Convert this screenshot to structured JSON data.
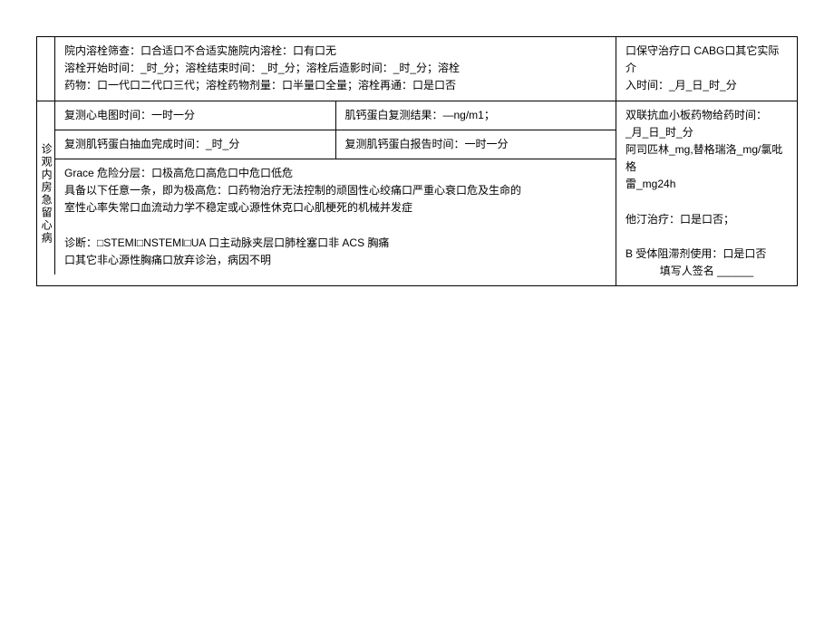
{
  "row1": {
    "left_line1": "院内溶栓筛查：口合适口不合适实施院内溶栓：口有口无",
    "left_line2": "溶栓开始时间：_时_分；溶栓结束时间：_时_分；溶栓后造影时间：_时_分；溶栓",
    "left_line3": "药物：口一代口二代口三代；溶栓药物剂量：口半量口全量；溶栓再通：口是口否",
    "right_line1": "口保守治疗口 CABG口其它实际介",
    "right_line2": "入时间：_月_日_时_分"
  },
  "row2": {
    "vlabel": "诊观内房急留心病",
    "sub1_left": "复测心电图时间：一时一分",
    "sub1_right": "肌钙蛋白复测结果：—ng/m1；",
    "sub2_left": "复测肌钙蛋白抽血完成时间：_时_分",
    "sub2_right": "复测肌钙蛋白报告时间：一时一分",
    "grace_line1": "Grace 危险分层：口极高危口高危口中危口低危",
    "grace_line2": "具备以下任意一条，即为极高危：口药物治疗无法控制的顽固性心绞痛口严重心衰口危及生命的",
    "grace_line3": "室性心率失常口血流动力学不稳定或心源性休克口心肌梗死的机械并发症",
    "diag_line1": "诊断：□STEMI□NSTEMI□UA 口主动脉夹层口肺栓塞口非 ACS 胸痛",
    "diag_line2": "口其它非心源性胸痛口放弃诊治，病因不明",
    "r_line1": "双联抗血小板药物给药时间：",
    "r_line2": "_月_日_时_分",
    "r_line3": "阿司匹林_mg,替格瑞洛_mg/氯吡格",
    "r_line4": "雷_mg24h",
    "r_line5": "他汀治疗：口是口否；",
    "r_line6": "B 受体阻滞剂使用：口是口否",
    "r_sig": "填写人签名 ______"
  }
}
